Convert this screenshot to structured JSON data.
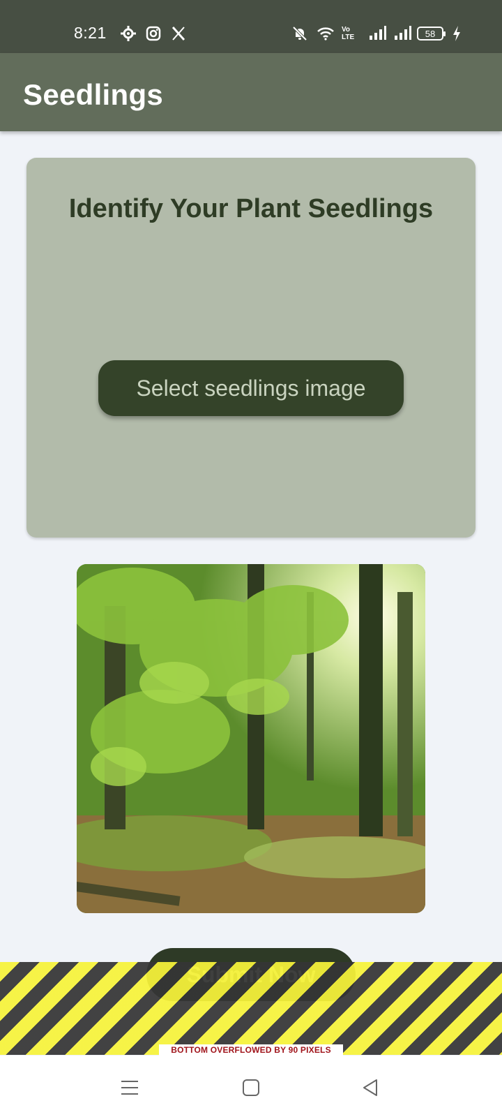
{
  "status_bar": {
    "time": "8:21",
    "left_icons": [
      "gear-icon",
      "instagram-icon",
      "x-icon"
    ],
    "right_icons": [
      "bell-off-icon",
      "wifi-icon",
      "volte-icon",
      "signal-icon",
      "signal-icon",
      "battery-icon",
      "charging-icon"
    ],
    "volte_label": "Vo LTE",
    "battery_level": "58"
  },
  "app_bar": {
    "title": "Seedlings",
    "background": "#626d5b"
  },
  "card": {
    "title": "Identify Your Plant Seedlings",
    "select_button_label": "Select seedlings image"
  },
  "image": {
    "alt": "forest-photo"
  },
  "submit_button_label": "Submit Now",
  "overflow_warning": "BOTTOM OVERFLOWED BY 90 PIXELS",
  "nav_bar": {
    "buttons": [
      "menu-icon",
      "home-icon",
      "back-icon"
    ]
  },
  "colors": {
    "status_bar": "#474f43",
    "card_bg": "#b2bbaa",
    "button_bg": "#344329",
    "page_bg": "#f0f3f8"
  }
}
